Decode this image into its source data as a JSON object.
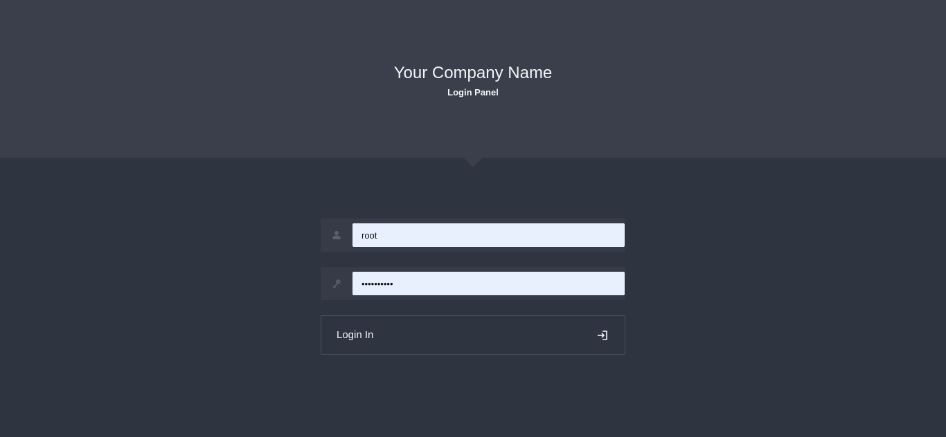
{
  "header": {
    "company_name": "Your Company Name",
    "subtitle": "Login Panel"
  },
  "form": {
    "username": {
      "icon": "user-icon",
      "value": "root"
    },
    "password": {
      "icon": "key-icon",
      "value": "••••••••••"
    },
    "submit": {
      "label": "Login In",
      "icon": "sign-in-icon"
    }
  },
  "colors": {
    "header_bg": "#3a3f4b",
    "page_bg": "#2f3441",
    "input_bg": "#e8f0fe",
    "field_group_bg": "#363b47",
    "text_light": "#f2f3f5"
  }
}
